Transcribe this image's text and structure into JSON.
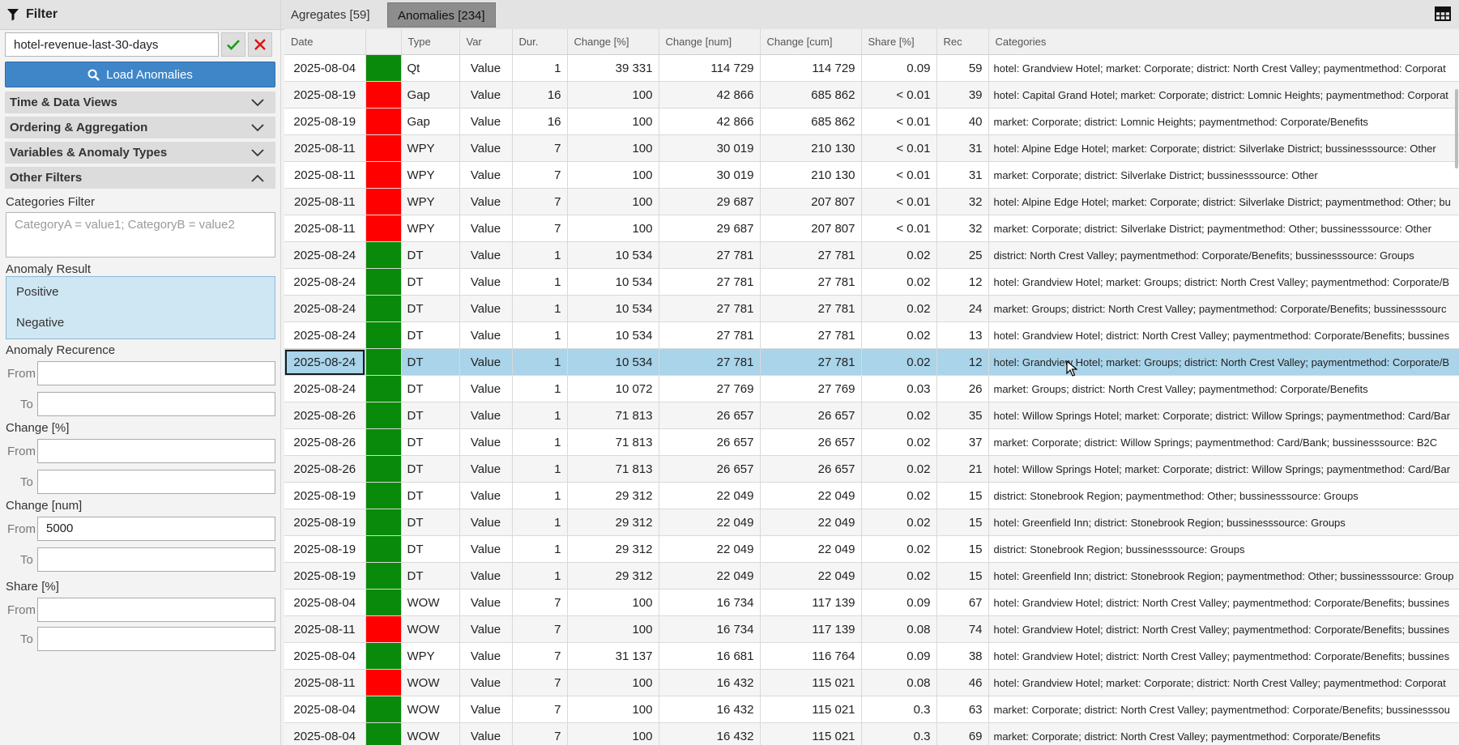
{
  "panel": {
    "title": "Filter",
    "preset_value": "hotel-revenue-last-30-days",
    "load_button": "Load Anomalies",
    "sections": {
      "time": "Time & Data Views",
      "ordering": "Ordering & Aggregation",
      "variables": "Variables & Anomaly Types",
      "other": "Other Filters"
    },
    "categories_filter_label": "Categories Filter",
    "categories_filter_placeholder": "CategoryA = value1; CategoryB = value2",
    "anomaly_result_label": "Anomaly Result",
    "anomaly_result_options": [
      "Positive",
      "Negative"
    ],
    "recurrence_label": "Anomaly Recurence",
    "change_pct_label": "Change [%]",
    "change_num_label": "Change [num]",
    "change_num_from": "5000",
    "share_label": "Share [%]",
    "from_label": "From",
    "to_label": "To"
  },
  "tabs": {
    "aggregates": "Agregates [59]",
    "anomalies": "Anomalies [234]"
  },
  "colors": {
    "positive": "#0a8a0a",
    "negative": "#ff0000",
    "selected_row": "#a9d4ea",
    "load_button": "#3f86c9"
  },
  "table": {
    "headers": [
      "Date",
      "",
      "Type",
      "Var",
      "Dur.",
      "Change [%]",
      "Change [num]",
      "Change [cum]",
      "Share [%]",
      "Rec",
      "Categories"
    ],
    "rows": [
      {
        "date": "2025-08-04",
        "result": "pos",
        "type": "Qt",
        "var": "Value",
        "dur": "1",
        "chg_pct": "39 331",
        "chg_num": "114 729",
        "chg_cum": "114 729",
        "share": "0.09",
        "rec": "59",
        "cat": "hotel: Grandview Hotel; market: Corporate; district: North Crest Valley; paymentmethod: Corporat"
      },
      {
        "date": "2025-08-19",
        "result": "neg",
        "type": "Gap",
        "var": "Value",
        "dur": "16",
        "chg_pct": "100",
        "chg_num": "42 866",
        "chg_cum": "685 862",
        "share": "< 0.01",
        "rec": "39",
        "cat": "hotel: Capital Grand Hotel; market: Corporate; district: Lomnic Heights; paymentmethod: Corporat"
      },
      {
        "date": "2025-08-19",
        "result": "neg",
        "type": "Gap",
        "var": "Value",
        "dur": "16",
        "chg_pct": "100",
        "chg_num": "42 866",
        "chg_cum": "685 862",
        "share": "< 0.01",
        "rec": "40",
        "cat": "market: Corporate; district: Lomnic Heights; paymentmethod: Corporate/Benefits"
      },
      {
        "date": "2025-08-11",
        "result": "neg",
        "type": "WPY",
        "var": "Value",
        "dur": "7",
        "chg_pct": "100",
        "chg_num": "30 019",
        "chg_cum": "210 130",
        "share": "< 0.01",
        "rec": "31",
        "cat": "hotel: Alpine Edge Hotel; market: Corporate; district: Silverlake District; bussinesssource: Other"
      },
      {
        "date": "2025-08-11",
        "result": "neg",
        "type": "WPY",
        "var": "Value",
        "dur": "7",
        "chg_pct": "100",
        "chg_num": "30 019",
        "chg_cum": "210 130",
        "share": "< 0.01",
        "rec": "31",
        "cat": "market: Corporate; district: Silverlake District; bussinesssource: Other"
      },
      {
        "date": "2025-08-11",
        "result": "neg",
        "type": "WPY",
        "var": "Value",
        "dur": "7",
        "chg_pct": "100",
        "chg_num": "29 687",
        "chg_cum": "207 807",
        "share": "< 0.01",
        "rec": "32",
        "cat": "hotel: Alpine Edge Hotel; market: Corporate; district: Silverlake District; paymentmethod: Other; bu"
      },
      {
        "date": "2025-08-11",
        "result": "neg",
        "type": "WPY",
        "var": "Value",
        "dur": "7",
        "chg_pct": "100",
        "chg_num": "29 687",
        "chg_cum": "207 807",
        "share": "< 0.01",
        "rec": "32",
        "cat": "market: Corporate; district: Silverlake District; paymentmethod: Other; bussinesssource: Other"
      },
      {
        "date": "2025-08-24",
        "result": "pos",
        "type": "DT",
        "var": "Value",
        "dur": "1",
        "chg_pct": "10 534",
        "chg_num": "27 781",
        "chg_cum": "27 781",
        "share": "0.02",
        "rec": "25",
        "cat": "district: North Crest Valley; paymentmethod: Corporate/Benefits; bussinesssource: Groups"
      },
      {
        "date": "2025-08-24",
        "result": "pos",
        "type": "DT",
        "var": "Value",
        "dur": "1",
        "chg_pct": "10 534",
        "chg_num": "27 781",
        "chg_cum": "27 781",
        "share": "0.02",
        "rec": "12",
        "cat": "hotel: Grandview Hotel; market: Groups; district: North Crest Valley; paymentmethod: Corporate/B"
      },
      {
        "date": "2025-08-24",
        "result": "pos",
        "type": "DT",
        "var": "Value",
        "dur": "1",
        "chg_pct": "10 534",
        "chg_num": "27 781",
        "chg_cum": "27 781",
        "share": "0.02",
        "rec": "24",
        "cat": "market: Groups; district: North Crest Valley; paymentmethod: Corporate/Benefits; bussinesssourc"
      },
      {
        "date": "2025-08-24",
        "result": "pos",
        "type": "DT",
        "var": "Value",
        "dur": "1",
        "chg_pct": "10 534",
        "chg_num": "27 781",
        "chg_cum": "27 781",
        "share": "0.02",
        "rec": "13",
        "cat": "hotel: Grandview Hotel; district: North Crest Valley; paymentmethod: Corporate/Benefits; bussines"
      },
      {
        "date": "2025-08-24",
        "result": "pos",
        "type": "DT",
        "var": "Value",
        "dur": "1",
        "chg_pct": "10 534",
        "chg_num": "27 781",
        "chg_cum": "27 781",
        "share": "0.02",
        "rec": "12",
        "cat": "hotel: Grandview Hotel; market: Groups; district: North Crest Valley; paymentmethod: Corporate/B",
        "selected": true
      },
      {
        "date": "2025-08-24",
        "result": "pos",
        "type": "DT",
        "var": "Value",
        "dur": "1",
        "chg_pct": "10 072",
        "chg_num": "27 769",
        "chg_cum": "27 769",
        "share": "0.03",
        "rec": "26",
        "cat": "market: Groups; district: North Crest Valley; paymentmethod: Corporate/Benefits"
      },
      {
        "date": "2025-08-26",
        "result": "pos",
        "type": "DT",
        "var": "Value",
        "dur": "1",
        "chg_pct": "71 813",
        "chg_num": "26 657",
        "chg_cum": "26 657",
        "share": "0.02",
        "rec": "35",
        "cat": "hotel: Willow Springs Hotel; market: Corporate; district: Willow Springs; paymentmethod: Card/Bar"
      },
      {
        "date": "2025-08-26",
        "result": "pos",
        "type": "DT",
        "var": "Value",
        "dur": "1",
        "chg_pct": "71 813",
        "chg_num": "26 657",
        "chg_cum": "26 657",
        "share": "0.02",
        "rec": "37",
        "cat": "market: Corporate; district: Willow Springs; paymentmethod: Card/Bank; bussinesssource: B2C"
      },
      {
        "date": "2025-08-26",
        "result": "pos",
        "type": "DT",
        "var": "Value",
        "dur": "1",
        "chg_pct": "71 813",
        "chg_num": "26 657",
        "chg_cum": "26 657",
        "share": "0.02",
        "rec": "21",
        "cat": "hotel: Willow Springs Hotel; market: Corporate; district: Willow Springs; paymentmethod: Card/Bar"
      },
      {
        "date": "2025-08-19",
        "result": "pos",
        "type": "DT",
        "var": "Value",
        "dur": "1",
        "chg_pct": "29 312",
        "chg_num": "22 049",
        "chg_cum": "22 049",
        "share": "0.02",
        "rec": "15",
        "cat": "district: Stonebrook Region; paymentmethod: Other; bussinesssource: Groups"
      },
      {
        "date": "2025-08-19",
        "result": "pos",
        "type": "DT",
        "var": "Value",
        "dur": "1",
        "chg_pct": "29 312",
        "chg_num": "22 049",
        "chg_cum": "22 049",
        "share": "0.02",
        "rec": "15",
        "cat": "hotel: Greenfield Inn; district: Stonebrook Region; bussinesssource: Groups"
      },
      {
        "date": "2025-08-19",
        "result": "pos",
        "type": "DT",
        "var": "Value",
        "dur": "1",
        "chg_pct": "29 312",
        "chg_num": "22 049",
        "chg_cum": "22 049",
        "share": "0.02",
        "rec": "15",
        "cat": "district: Stonebrook Region; bussinesssource: Groups"
      },
      {
        "date": "2025-08-19",
        "result": "pos",
        "type": "DT",
        "var": "Value",
        "dur": "1",
        "chg_pct": "29 312",
        "chg_num": "22 049",
        "chg_cum": "22 049",
        "share": "0.02",
        "rec": "15",
        "cat": "hotel: Greenfield Inn; district: Stonebrook Region; paymentmethod: Other; bussinesssource: Group"
      },
      {
        "date": "2025-08-04",
        "result": "pos",
        "type": "WOW",
        "var": "Value",
        "dur": "7",
        "chg_pct": "100",
        "chg_num": "16 734",
        "chg_cum": "117 139",
        "share": "0.09",
        "rec": "67",
        "cat": "hotel: Grandview Hotel; district: North Crest Valley; paymentmethod: Corporate/Benefits; bussines"
      },
      {
        "date": "2025-08-11",
        "result": "neg",
        "type": "WOW",
        "var": "Value",
        "dur": "7",
        "chg_pct": "100",
        "chg_num": "16 734",
        "chg_cum": "117 139",
        "share": "0.08",
        "rec": "74",
        "cat": "hotel: Grandview Hotel; district: North Crest Valley; paymentmethod: Corporate/Benefits; bussines"
      },
      {
        "date": "2025-08-04",
        "result": "pos",
        "type": "WPY",
        "var": "Value",
        "dur": "7",
        "chg_pct": "31 137",
        "chg_num": "16 681",
        "chg_cum": "116 764",
        "share": "0.09",
        "rec": "38",
        "cat": "hotel: Grandview Hotel; district: North Crest Valley; paymentmethod: Corporate/Benefits; bussines"
      },
      {
        "date": "2025-08-11",
        "result": "neg",
        "type": "WOW",
        "var": "Value",
        "dur": "7",
        "chg_pct": "100",
        "chg_num": "16 432",
        "chg_cum": "115 021",
        "share": "0.08",
        "rec": "46",
        "cat": "hotel: Grandview Hotel; market: Corporate; district: North Crest Valley; paymentmethod: Corporat"
      },
      {
        "date": "2025-08-04",
        "result": "pos",
        "type": "WOW",
        "var": "Value",
        "dur": "7",
        "chg_pct": "100",
        "chg_num": "16 432",
        "chg_cum": "115 021",
        "share": "0.3",
        "rec": "63",
        "cat": "market: Corporate; district: North Crest Valley; paymentmethod: Corporate/Benefits; bussinesssou"
      },
      {
        "date": "2025-08-04",
        "result": "pos",
        "type": "WOW",
        "var": "Value",
        "dur": "7",
        "chg_pct": "100",
        "chg_num": "16 432",
        "chg_cum": "115 021",
        "share": "0.3",
        "rec": "69",
        "cat": "market: Corporate; district: North Crest Valley; paymentmethod: Corporate/Benefits"
      }
    ]
  }
}
